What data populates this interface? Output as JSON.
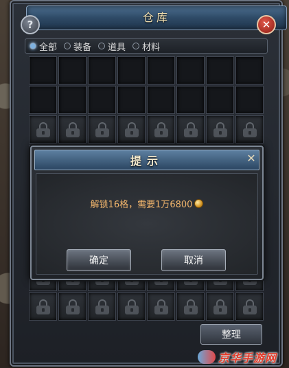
{
  "window": {
    "title": "仓库"
  },
  "buttons": {
    "help": "?",
    "close": "✕",
    "sort": "整理"
  },
  "tabs": [
    {
      "label": "全部",
      "active": true
    },
    {
      "label": "装备",
      "active": false
    },
    {
      "label": "道具",
      "active": false
    },
    {
      "label": "材料",
      "active": false
    }
  ],
  "grid": {
    "columns": 8,
    "rows": 9,
    "unlocked_rows": 2
  },
  "dialog": {
    "title": "提示",
    "close": "✕",
    "message": "解锁16格，需要1万6800",
    "currency_icon": "gold-coin-icon",
    "confirm_label": "确定",
    "cancel_label": "取消"
  },
  "watermark": {
    "text": "京华手游网"
  },
  "colors": {
    "title_bar": "#2e4a66",
    "message_text": "#f1b56c",
    "active_tab": "#7fb2e0"
  }
}
